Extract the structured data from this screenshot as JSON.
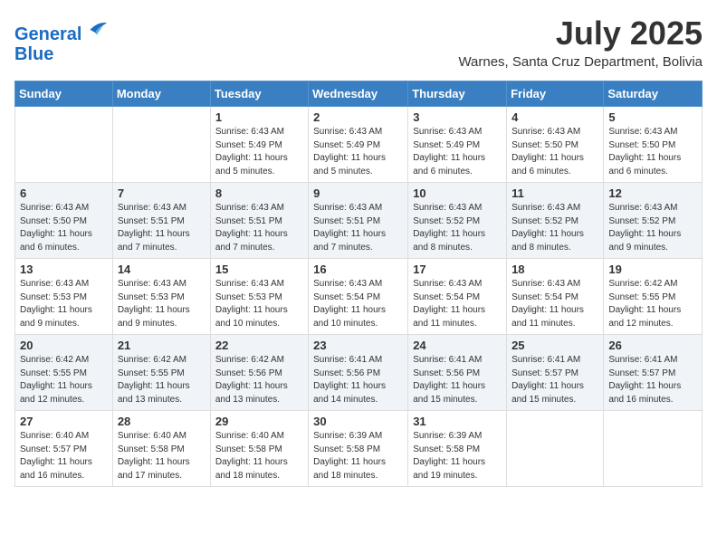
{
  "header": {
    "logo_line1": "General",
    "logo_line2": "Blue",
    "month_title": "July 2025",
    "location": "Warnes, Santa Cruz Department, Bolivia"
  },
  "days_of_week": [
    "Sunday",
    "Monday",
    "Tuesday",
    "Wednesday",
    "Thursday",
    "Friday",
    "Saturday"
  ],
  "weeks": [
    [
      {
        "day": "",
        "info": ""
      },
      {
        "day": "",
        "info": ""
      },
      {
        "day": "1",
        "info": "Sunrise: 6:43 AM\nSunset: 5:49 PM\nDaylight: 11 hours and 5 minutes."
      },
      {
        "day": "2",
        "info": "Sunrise: 6:43 AM\nSunset: 5:49 PM\nDaylight: 11 hours and 5 minutes."
      },
      {
        "day": "3",
        "info": "Sunrise: 6:43 AM\nSunset: 5:49 PM\nDaylight: 11 hours and 6 minutes."
      },
      {
        "day": "4",
        "info": "Sunrise: 6:43 AM\nSunset: 5:50 PM\nDaylight: 11 hours and 6 minutes."
      },
      {
        "day": "5",
        "info": "Sunrise: 6:43 AM\nSunset: 5:50 PM\nDaylight: 11 hours and 6 minutes."
      }
    ],
    [
      {
        "day": "6",
        "info": "Sunrise: 6:43 AM\nSunset: 5:50 PM\nDaylight: 11 hours and 6 minutes."
      },
      {
        "day": "7",
        "info": "Sunrise: 6:43 AM\nSunset: 5:51 PM\nDaylight: 11 hours and 7 minutes."
      },
      {
        "day": "8",
        "info": "Sunrise: 6:43 AM\nSunset: 5:51 PM\nDaylight: 11 hours and 7 minutes."
      },
      {
        "day": "9",
        "info": "Sunrise: 6:43 AM\nSunset: 5:51 PM\nDaylight: 11 hours and 7 minutes."
      },
      {
        "day": "10",
        "info": "Sunrise: 6:43 AM\nSunset: 5:52 PM\nDaylight: 11 hours and 8 minutes."
      },
      {
        "day": "11",
        "info": "Sunrise: 6:43 AM\nSunset: 5:52 PM\nDaylight: 11 hours and 8 minutes."
      },
      {
        "day": "12",
        "info": "Sunrise: 6:43 AM\nSunset: 5:52 PM\nDaylight: 11 hours and 9 minutes."
      }
    ],
    [
      {
        "day": "13",
        "info": "Sunrise: 6:43 AM\nSunset: 5:53 PM\nDaylight: 11 hours and 9 minutes."
      },
      {
        "day": "14",
        "info": "Sunrise: 6:43 AM\nSunset: 5:53 PM\nDaylight: 11 hours and 9 minutes."
      },
      {
        "day": "15",
        "info": "Sunrise: 6:43 AM\nSunset: 5:53 PM\nDaylight: 11 hours and 10 minutes."
      },
      {
        "day": "16",
        "info": "Sunrise: 6:43 AM\nSunset: 5:54 PM\nDaylight: 11 hours and 10 minutes."
      },
      {
        "day": "17",
        "info": "Sunrise: 6:43 AM\nSunset: 5:54 PM\nDaylight: 11 hours and 11 minutes."
      },
      {
        "day": "18",
        "info": "Sunrise: 6:43 AM\nSunset: 5:54 PM\nDaylight: 11 hours and 11 minutes."
      },
      {
        "day": "19",
        "info": "Sunrise: 6:42 AM\nSunset: 5:55 PM\nDaylight: 11 hours and 12 minutes."
      }
    ],
    [
      {
        "day": "20",
        "info": "Sunrise: 6:42 AM\nSunset: 5:55 PM\nDaylight: 11 hours and 12 minutes."
      },
      {
        "day": "21",
        "info": "Sunrise: 6:42 AM\nSunset: 5:55 PM\nDaylight: 11 hours and 13 minutes."
      },
      {
        "day": "22",
        "info": "Sunrise: 6:42 AM\nSunset: 5:56 PM\nDaylight: 11 hours and 13 minutes."
      },
      {
        "day": "23",
        "info": "Sunrise: 6:41 AM\nSunset: 5:56 PM\nDaylight: 11 hours and 14 minutes."
      },
      {
        "day": "24",
        "info": "Sunrise: 6:41 AM\nSunset: 5:56 PM\nDaylight: 11 hours and 15 minutes."
      },
      {
        "day": "25",
        "info": "Sunrise: 6:41 AM\nSunset: 5:57 PM\nDaylight: 11 hours and 15 minutes."
      },
      {
        "day": "26",
        "info": "Sunrise: 6:41 AM\nSunset: 5:57 PM\nDaylight: 11 hours and 16 minutes."
      }
    ],
    [
      {
        "day": "27",
        "info": "Sunrise: 6:40 AM\nSunset: 5:57 PM\nDaylight: 11 hours and 16 minutes."
      },
      {
        "day": "28",
        "info": "Sunrise: 6:40 AM\nSunset: 5:58 PM\nDaylight: 11 hours and 17 minutes."
      },
      {
        "day": "29",
        "info": "Sunrise: 6:40 AM\nSunset: 5:58 PM\nDaylight: 11 hours and 18 minutes."
      },
      {
        "day": "30",
        "info": "Sunrise: 6:39 AM\nSunset: 5:58 PM\nDaylight: 11 hours and 18 minutes."
      },
      {
        "day": "31",
        "info": "Sunrise: 6:39 AM\nSunset: 5:58 PM\nDaylight: 11 hours and 19 minutes."
      },
      {
        "day": "",
        "info": ""
      },
      {
        "day": "",
        "info": ""
      }
    ]
  ]
}
